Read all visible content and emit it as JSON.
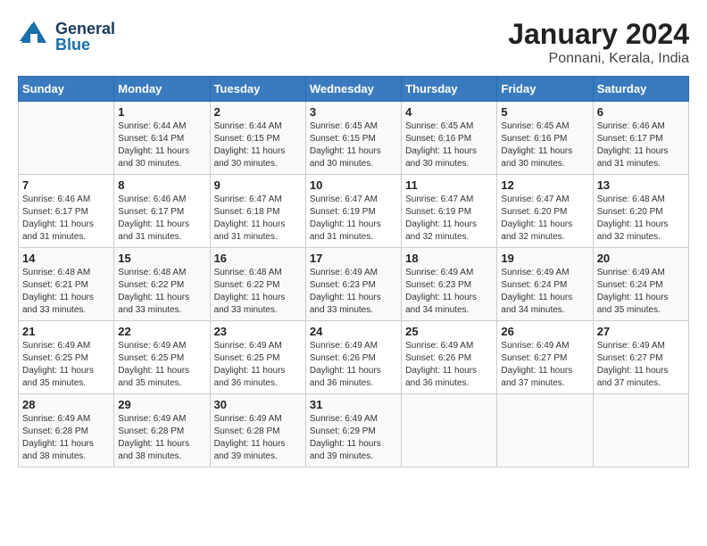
{
  "header": {
    "logo_general": "General",
    "logo_blue": "Blue",
    "title": "January 2024",
    "subtitle": "Ponnani, Kerala, India"
  },
  "calendar": {
    "days_of_week": [
      "Sunday",
      "Monday",
      "Tuesday",
      "Wednesday",
      "Thursday",
      "Friday",
      "Saturday"
    ],
    "weeks": [
      [
        {
          "num": "",
          "sunrise": "",
          "sunset": "",
          "daylight": ""
        },
        {
          "num": "1",
          "sunrise": "Sunrise: 6:44 AM",
          "sunset": "Sunset: 6:14 PM",
          "daylight": "Daylight: 11 hours and 30 minutes."
        },
        {
          "num": "2",
          "sunrise": "Sunrise: 6:44 AM",
          "sunset": "Sunset: 6:15 PM",
          "daylight": "Daylight: 11 hours and 30 minutes."
        },
        {
          "num": "3",
          "sunrise": "Sunrise: 6:45 AM",
          "sunset": "Sunset: 6:15 PM",
          "daylight": "Daylight: 11 hours and 30 minutes."
        },
        {
          "num": "4",
          "sunrise": "Sunrise: 6:45 AM",
          "sunset": "Sunset: 6:16 PM",
          "daylight": "Daylight: 11 hours and 30 minutes."
        },
        {
          "num": "5",
          "sunrise": "Sunrise: 6:45 AM",
          "sunset": "Sunset: 6:16 PM",
          "daylight": "Daylight: 11 hours and 30 minutes."
        },
        {
          "num": "6",
          "sunrise": "Sunrise: 6:46 AM",
          "sunset": "Sunset: 6:17 PM",
          "daylight": "Daylight: 11 hours and 31 minutes."
        }
      ],
      [
        {
          "num": "7",
          "sunrise": "Sunrise: 6:46 AM",
          "sunset": "Sunset: 6:17 PM",
          "daylight": "Daylight: 11 hours and 31 minutes."
        },
        {
          "num": "8",
          "sunrise": "Sunrise: 6:46 AM",
          "sunset": "Sunset: 6:17 PM",
          "daylight": "Daylight: 11 hours and 31 minutes."
        },
        {
          "num": "9",
          "sunrise": "Sunrise: 6:47 AM",
          "sunset": "Sunset: 6:18 PM",
          "daylight": "Daylight: 11 hours and 31 minutes."
        },
        {
          "num": "10",
          "sunrise": "Sunrise: 6:47 AM",
          "sunset": "Sunset: 6:19 PM",
          "daylight": "Daylight: 11 hours and 31 minutes."
        },
        {
          "num": "11",
          "sunrise": "Sunrise: 6:47 AM",
          "sunset": "Sunset: 6:19 PM",
          "daylight": "Daylight: 11 hours and 32 minutes."
        },
        {
          "num": "12",
          "sunrise": "Sunrise: 6:47 AM",
          "sunset": "Sunset: 6:20 PM",
          "daylight": "Daylight: 11 hours and 32 minutes."
        },
        {
          "num": "13",
          "sunrise": "Sunrise: 6:48 AM",
          "sunset": "Sunset: 6:20 PM",
          "daylight": "Daylight: 11 hours and 32 minutes."
        }
      ],
      [
        {
          "num": "14",
          "sunrise": "Sunrise: 6:48 AM",
          "sunset": "Sunset: 6:21 PM",
          "daylight": "Daylight: 11 hours and 33 minutes."
        },
        {
          "num": "15",
          "sunrise": "Sunrise: 6:48 AM",
          "sunset": "Sunset: 6:22 PM",
          "daylight": "Daylight: 11 hours and 33 minutes."
        },
        {
          "num": "16",
          "sunrise": "Sunrise: 6:48 AM",
          "sunset": "Sunset: 6:22 PM",
          "daylight": "Daylight: 11 hours and 33 minutes."
        },
        {
          "num": "17",
          "sunrise": "Sunrise: 6:49 AM",
          "sunset": "Sunset: 6:23 PM",
          "daylight": "Daylight: 11 hours and 33 minutes."
        },
        {
          "num": "18",
          "sunrise": "Sunrise: 6:49 AM",
          "sunset": "Sunset: 6:23 PM",
          "daylight": "Daylight: 11 hours and 34 minutes."
        },
        {
          "num": "19",
          "sunrise": "Sunrise: 6:49 AM",
          "sunset": "Sunset: 6:24 PM",
          "daylight": "Daylight: 11 hours and 34 minutes."
        },
        {
          "num": "20",
          "sunrise": "Sunrise: 6:49 AM",
          "sunset": "Sunset: 6:24 PM",
          "daylight": "Daylight: 11 hours and 35 minutes."
        }
      ],
      [
        {
          "num": "21",
          "sunrise": "Sunrise: 6:49 AM",
          "sunset": "Sunset: 6:25 PM",
          "daylight": "Daylight: 11 hours and 35 minutes."
        },
        {
          "num": "22",
          "sunrise": "Sunrise: 6:49 AM",
          "sunset": "Sunset: 6:25 PM",
          "daylight": "Daylight: 11 hours and 35 minutes."
        },
        {
          "num": "23",
          "sunrise": "Sunrise: 6:49 AM",
          "sunset": "Sunset: 6:25 PM",
          "daylight": "Daylight: 11 hours and 36 minutes."
        },
        {
          "num": "24",
          "sunrise": "Sunrise: 6:49 AM",
          "sunset": "Sunset: 6:26 PM",
          "daylight": "Daylight: 11 hours and 36 minutes."
        },
        {
          "num": "25",
          "sunrise": "Sunrise: 6:49 AM",
          "sunset": "Sunset: 6:26 PM",
          "daylight": "Daylight: 11 hours and 36 minutes."
        },
        {
          "num": "26",
          "sunrise": "Sunrise: 6:49 AM",
          "sunset": "Sunset: 6:27 PM",
          "daylight": "Daylight: 11 hours and 37 minutes."
        },
        {
          "num": "27",
          "sunrise": "Sunrise: 6:49 AM",
          "sunset": "Sunset: 6:27 PM",
          "daylight": "Daylight: 11 hours and 37 minutes."
        }
      ],
      [
        {
          "num": "28",
          "sunrise": "Sunrise: 6:49 AM",
          "sunset": "Sunset: 6:28 PM",
          "daylight": "Daylight: 11 hours and 38 minutes."
        },
        {
          "num": "29",
          "sunrise": "Sunrise: 6:49 AM",
          "sunset": "Sunset: 6:28 PM",
          "daylight": "Daylight: 11 hours and 38 minutes."
        },
        {
          "num": "30",
          "sunrise": "Sunrise: 6:49 AM",
          "sunset": "Sunset: 6:28 PM",
          "daylight": "Daylight: 11 hours and 39 minutes."
        },
        {
          "num": "31",
          "sunrise": "Sunrise: 6:49 AM",
          "sunset": "Sunset: 6:29 PM",
          "daylight": "Daylight: 11 hours and 39 minutes."
        },
        {
          "num": "",
          "sunrise": "",
          "sunset": "",
          "daylight": ""
        },
        {
          "num": "",
          "sunrise": "",
          "sunset": "",
          "daylight": ""
        },
        {
          "num": "",
          "sunrise": "",
          "sunset": "",
          "daylight": ""
        }
      ]
    ]
  }
}
